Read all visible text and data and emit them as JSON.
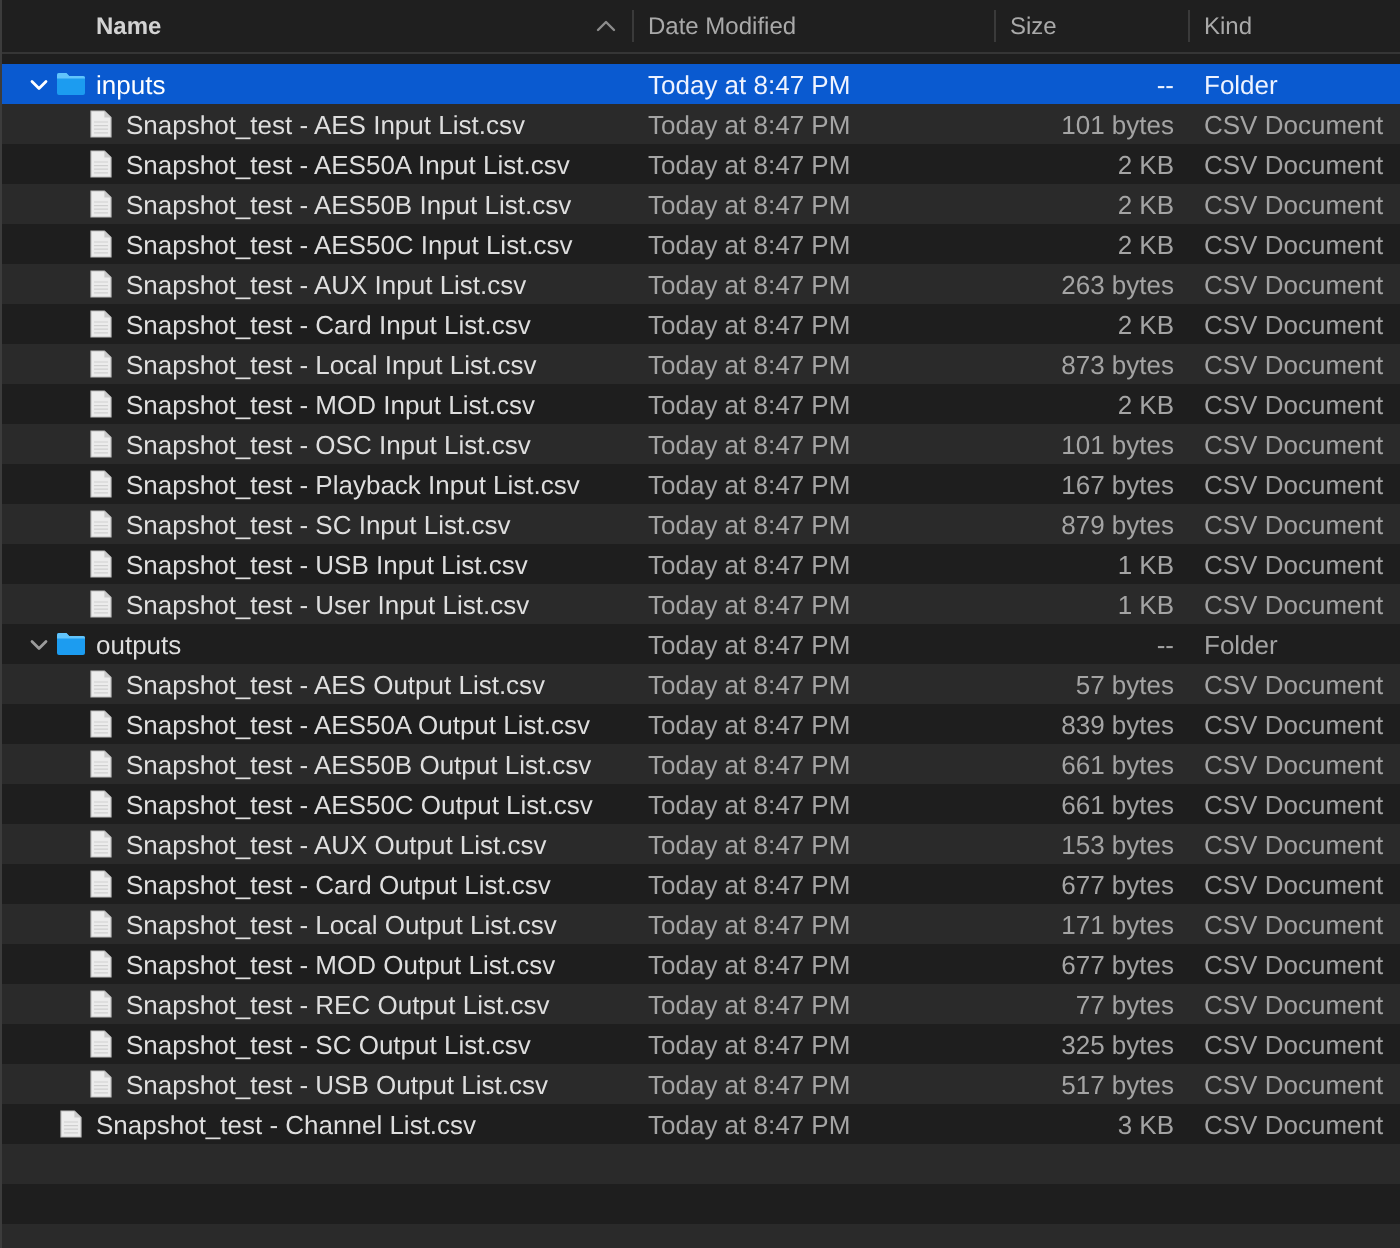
{
  "columns": [
    {
      "label": "Name",
      "sorted": true
    },
    {
      "label": "Date Modified",
      "sorted": false
    },
    {
      "label": "Size",
      "sorted": false
    },
    {
      "label": "Kind",
      "sorted": false
    }
  ],
  "items": [
    {
      "kind": "folder",
      "name": "inputs",
      "date_modified": "Today at 8:47 PM",
      "size": "--",
      "file_kind": "Folder",
      "expanded": true,
      "selected": true,
      "children": [
        {
          "kind": "document",
          "name": "Snapshot_test - AES Input List.csv",
          "date_modified": "Today at 8:47 PM",
          "size": "101 bytes",
          "file_kind": "CSV Document",
          "selected": false
        },
        {
          "kind": "document",
          "name": "Snapshot_test - AES50A Input List.csv",
          "date_modified": "Today at 8:47 PM",
          "size": "2 KB",
          "file_kind": "CSV Document",
          "selected": false
        },
        {
          "kind": "document",
          "name": "Snapshot_test - AES50B Input List.csv",
          "date_modified": "Today at 8:47 PM",
          "size": "2 KB",
          "file_kind": "CSV Document",
          "selected": false
        },
        {
          "kind": "document",
          "name": "Snapshot_test - AES50C Input List.csv",
          "date_modified": "Today at 8:47 PM",
          "size": "2 KB",
          "file_kind": "CSV Document",
          "selected": false
        },
        {
          "kind": "document",
          "name": "Snapshot_test - AUX Input List.csv",
          "date_modified": "Today at 8:47 PM",
          "size": "263 bytes",
          "file_kind": "CSV Document",
          "selected": false
        },
        {
          "kind": "document",
          "name": "Snapshot_test - Card Input List.csv",
          "date_modified": "Today at 8:47 PM",
          "size": "2 KB",
          "file_kind": "CSV Document",
          "selected": false
        },
        {
          "kind": "document",
          "name": "Snapshot_test - Local Input List.csv",
          "date_modified": "Today at 8:47 PM",
          "size": "873 bytes",
          "file_kind": "CSV Document",
          "selected": false
        },
        {
          "kind": "document",
          "name": "Snapshot_test - MOD Input List.csv",
          "date_modified": "Today at 8:47 PM",
          "size": "2 KB",
          "file_kind": "CSV Document",
          "selected": false
        },
        {
          "kind": "document",
          "name": "Snapshot_test - OSC Input List.csv",
          "date_modified": "Today at 8:47 PM",
          "size": "101 bytes",
          "file_kind": "CSV Document",
          "selected": false
        },
        {
          "kind": "document",
          "name": "Snapshot_test - Playback Input List.csv",
          "date_modified": "Today at 8:47 PM",
          "size": "167 bytes",
          "file_kind": "CSV Document",
          "selected": false
        },
        {
          "kind": "document",
          "name": "Snapshot_test - SC Input List.csv",
          "date_modified": "Today at 8:47 PM",
          "size": "879 bytes",
          "file_kind": "CSV Document",
          "selected": false
        },
        {
          "kind": "document",
          "name": "Snapshot_test - USB Input List.csv",
          "date_modified": "Today at 8:47 PM",
          "size": "1 KB",
          "file_kind": "CSV Document",
          "selected": false
        },
        {
          "kind": "document",
          "name": "Snapshot_test - User Input List.csv",
          "date_modified": "Today at 8:47 PM",
          "size": "1 KB",
          "file_kind": "CSV Document",
          "selected": false
        }
      ]
    },
    {
      "kind": "folder",
      "name": "outputs",
      "date_modified": "Today at 8:47 PM",
      "size": "--",
      "file_kind": "Folder",
      "expanded": true,
      "selected": false,
      "children": [
        {
          "kind": "document",
          "name": "Snapshot_test - AES Output List.csv",
          "date_modified": "Today at 8:47 PM",
          "size": "57 bytes",
          "file_kind": "CSV Document",
          "selected": false
        },
        {
          "kind": "document",
          "name": "Snapshot_test - AES50A Output List.csv",
          "date_modified": "Today at 8:47 PM",
          "size": "839 bytes",
          "file_kind": "CSV Document",
          "selected": false
        },
        {
          "kind": "document",
          "name": "Snapshot_test - AES50B Output List.csv",
          "date_modified": "Today at 8:47 PM",
          "size": "661 bytes",
          "file_kind": "CSV Document",
          "selected": false
        },
        {
          "kind": "document",
          "name": "Snapshot_test - AES50C Output List.csv",
          "date_modified": "Today at 8:47 PM",
          "size": "661 bytes",
          "file_kind": "CSV Document",
          "selected": false
        },
        {
          "kind": "document",
          "name": "Snapshot_test - AUX Output List.csv",
          "date_modified": "Today at 8:47 PM",
          "size": "153 bytes",
          "file_kind": "CSV Document",
          "selected": false
        },
        {
          "kind": "document",
          "name": "Snapshot_test - Card Output List.csv",
          "date_modified": "Today at 8:47 PM",
          "size": "677 bytes",
          "file_kind": "CSV Document",
          "selected": false
        },
        {
          "kind": "document",
          "name": "Snapshot_test - Local Output List.csv",
          "date_modified": "Today at 8:47 PM",
          "size": "171 bytes",
          "file_kind": "CSV Document",
          "selected": false
        },
        {
          "kind": "document",
          "name": "Snapshot_test - MOD Output List.csv",
          "date_modified": "Today at 8:47 PM",
          "size": "677 bytes",
          "file_kind": "CSV Document",
          "selected": false
        },
        {
          "kind": "document",
          "name": "Snapshot_test - REC Output List.csv",
          "date_modified": "Today at 8:47 PM",
          "size": "77 bytes",
          "file_kind": "CSV Document",
          "selected": false
        },
        {
          "kind": "document",
          "name": "Snapshot_test - SC Output List.csv",
          "date_modified": "Today at 8:47 PM",
          "size": "325 bytes",
          "file_kind": "CSV Document",
          "selected": false
        },
        {
          "kind": "document",
          "name": "Snapshot_test - USB Output List.csv",
          "date_modified": "Today at 8:47 PM",
          "size": "517 bytes",
          "file_kind": "CSV Document",
          "selected": false
        }
      ]
    },
    {
      "kind": "document",
      "name": "Snapshot_test - Channel List.csv",
      "date_modified": "Today at 8:47 PM",
      "size": "3 KB",
      "file_kind": "CSV Document",
      "selected": false
    }
  ]
}
